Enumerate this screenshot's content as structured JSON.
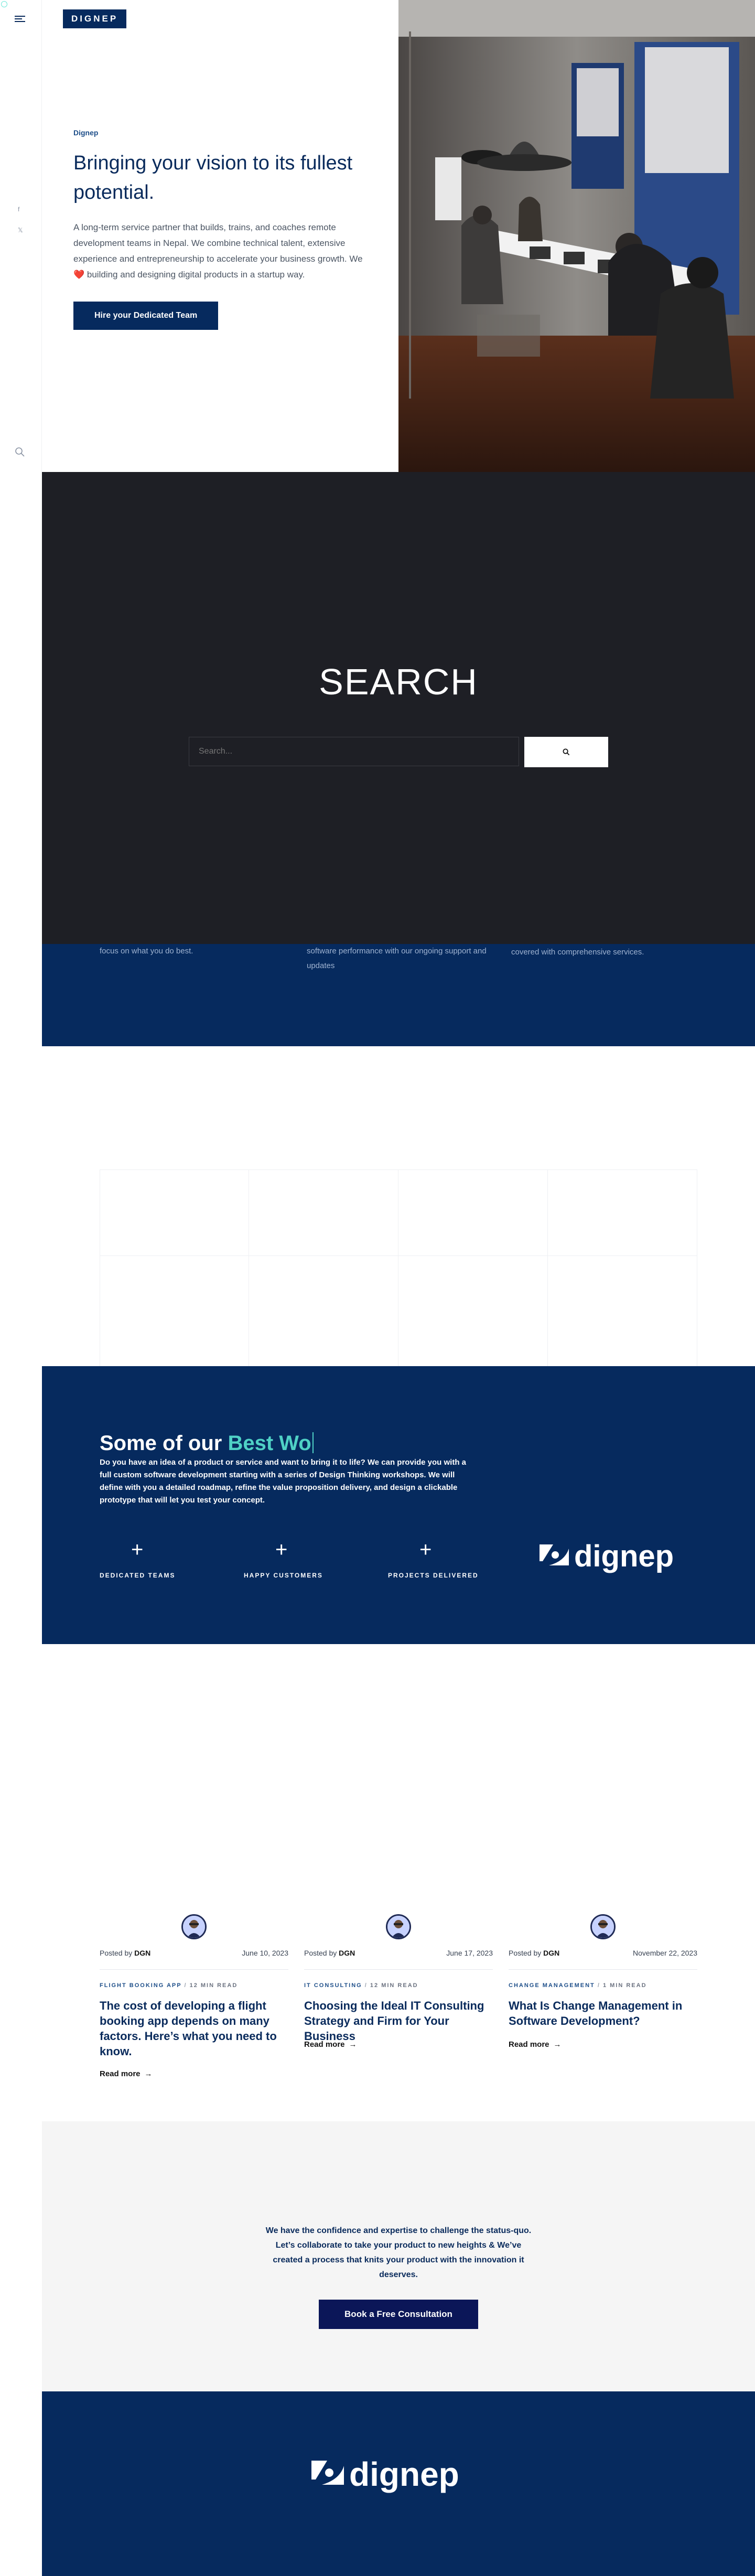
{
  "brand": {
    "badge": "DIGNEP",
    "wordmark": "dignep"
  },
  "hero": {
    "eyebrow": "Dignep",
    "title": "Bringing your vision to its fullest potential.",
    "description_pre": "A long-term service partner that builds, trains, and coaches remote development teams in Nepal. We combine technical talent, extensive experience and entrepreneurship to accelerate your business growth. We ",
    "heart": "❤️",
    "description_post": " building and designing digital products in a startup way.",
    "cta_label": "Hire your Dedicated Team"
  },
  "rail": {
    "facebook": "f",
    "twitter": "𝕏"
  },
  "search": {
    "title": "SEARCH",
    "placeholder": "Search..."
  },
  "services": {
    "items": [
      {
        "text": "focus on what you do best."
      },
      {
        "text": "software performance with our ongoing support and updates"
      },
      {
        "text": "covered with comprehensive services."
      }
    ]
  },
  "best_work": {
    "title_pre": "Some of our ",
    "title_accent": "Best Wo",
    "description": "Do you have an idea of a product or service and want to bring it to life? We can provide you with a full custom software development starting with a series of Design Thinking workshops. We will define with you a detailed roadmap, refine the value proposition delivery, and design a clickable prototype that will let you test your concept.",
    "stats": [
      {
        "plus": "+",
        "label": "DEDICATED TEAMS"
      },
      {
        "plus": "+",
        "label": "HAPPY CUSTOMERS"
      },
      {
        "plus": "+",
        "label": "PROJECTS DELIVERED"
      }
    ]
  },
  "blog": {
    "posted_by": "Posted by",
    "read_more": "Read more",
    "posts": [
      {
        "author": "DGN",
        "date": "June 10, 2023",
        "category": "FLIGHT BOOKING APP",
        "read_time": "12 MIN READ",
        "title": "The cost of developing a flight booking app depends on many factors. Here’s what you need to know."
      },
      {
        "author": "DGN",
        "date": "June 17, 2023",
        "category": "IT CONSULTING",
        "read_time": "12 MIN READ",
        "title": "Choosing the Ideal IT Consulting Strategy and Firm for Your Business"
      },
      {
        "author": "DGN",
        "date": "November 22, 2023",
        "category": "CHANGE MANAGEMENT",
        "read_time": "1 MIN READ",
        "title": "What Is Change Management in Software Development?"
      }
    ]
  },
  "cta": {
    "text": "We have the confidence and expertise to challenge the status-quo. Let’s collaborate to take your product to new heights & We’ve created a process that knits your product with the innovation it deserves.",
    "button": "Book a Free Consultation"
  },
  "colors": {
    "navy": "#062a5e",
    "accent": "#4fd1c5",
    "dark": "#1e1f25",
    "cta_button": "#0b1658",
    "light_bg": "#f5f5f5"
  }
}
